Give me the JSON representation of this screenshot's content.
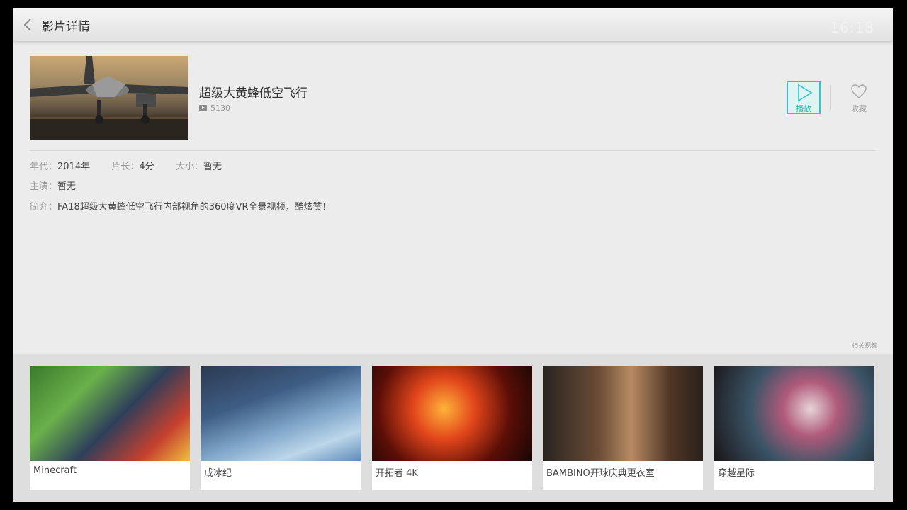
{
  "header": {
    "title": "影片详情",
    "clock": "16:18"
  },
  "movie": {
    "title": "超级大黄蜂低空飞行",
    "play_count": "5130",
    "actions": {
      "play_label": "播放",
      "favorite_label": "收藏"
    },
    "details": {
      "year_label": "年代：",
      "year": "2014年",
      "duration_label": "片长：",
      "duration": "4分",
      "size_label": "大小：",
      "size": "暂无",
      "cast_label": "主演：",
      "cast": "暂无",
      "synopsis_label": "简介：",
      "synopsis": "FA18超级大黄蜂低空飞行内部视角的360度VR全景视频，酷炫赞！"
    }
  },
  "related": {
    "label": "相关视频",
    "items": [
      {
        "title": "Minecraft"
      },
      {
        "title": "成冰纪"
      },
      {
        "title": "开拓者 4K"
      },
      {
        "title": "BAMBINO开球庆典更衣室"
      },
      {
        "title": "穿越星际"
      }
    ]
  },
  "colors": {
    "accent": "#35c3c6",
    "background": "#ececec"
  }
}
